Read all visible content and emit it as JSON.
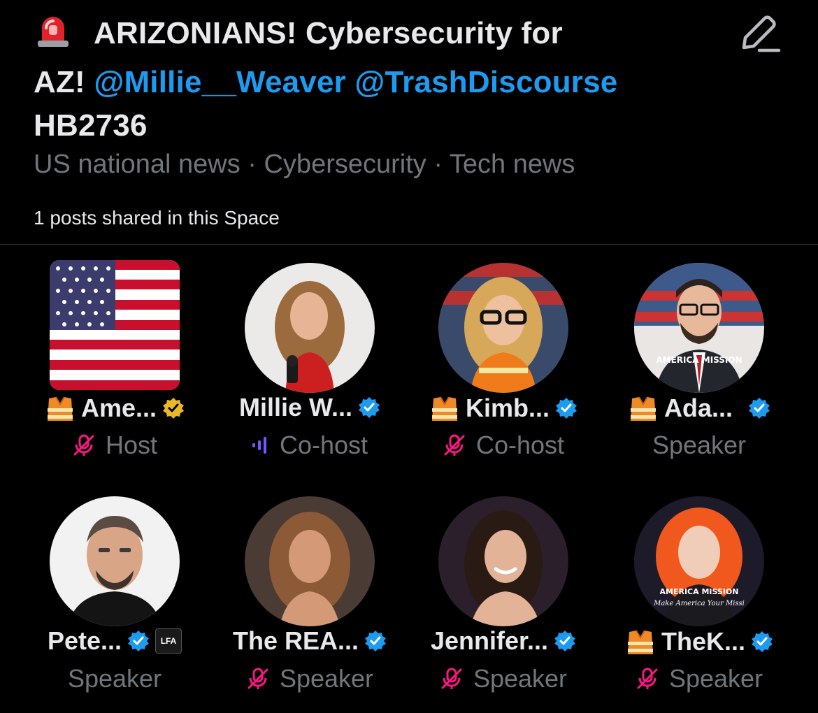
{
  "space": {
    "title_part1": "ARIZONIANS! Cybersecurity for",
    "title_part2_prefix": "AZ!",
    "mention1": "@Millie__Weaver",
    "mention2": "@TrashDiscourse",
    "title_part3": "HB2736",
    "topics": "US national news · Cybersecurity · Tech news",
    "shared_posts": "1 posts shared in this Space"
  },
  "colors": {
    "accent": "#1d9bf0",
    "muted": "#71767b",
    "mic_off": "#f91880",
    "speaking": "#7856ff",
    "gold": "#e8b829"
  },
  "participants": [
    {
      "name": "Ame...",
      "role": "Host",
      "emoji": "safety-vest",
      "badge": "gold-verified",
      "mic": "muted",
      "avatar": "us-flag"
    },
    {
      "name": "Millie W...",
      "role": "Co-host",
      "badge": "blue-verified",
      "mic": "speaking",
      "avatar": "portrait-blonde-red"
    },
    {
      "name": "Kimb...",
      "role": "Co-host",
      "emoji": "safety-vest",
      "badge": "blue-verified",
      "mic": "muted",
      "avatar": "portrait-glasses-flag"
    },
    {
      "name": "Ada...",
      "role": "Speaker",
      "emoji": "safety-vest",
      "badge": "blue-verified",
      "mic": "none",
      "avatar": "cartoon-man-flag",
      "avatar_text": "AMERICA MISSION"
    },
    {
      "name": "Pete...",
      "role": "Speaker",
      "badge": "blue-verified",
      "affiliate": "LFA",
      "mic": "none",
      "avatar": "portrait-man-beard"
    },
    {
      "name": "The REA...",
      "role": "Speaker",
      "badge": "blue-verified",
      "mic": "muted",
      "avatar": "portrait-woman-tan"
    },
    {
      "name": "Jennifer...",
      "role": "Speaker",
      "badge": "blue-verified",
      "mic": "muted",
      "avatar": "portrait-woman-dark"
    },
    {
      "name": "TheK...",
      "role": "Speaker",
      "emoji": "safety-vest",
      "badge": "blue-verified",
      "mic": "muted",
      "avatar": "portrait-redhead",
      "avatar_text": "AMERICA MISSION",
      "avatar_subtext": "Make America Your Missi"
    }
  ]
}
